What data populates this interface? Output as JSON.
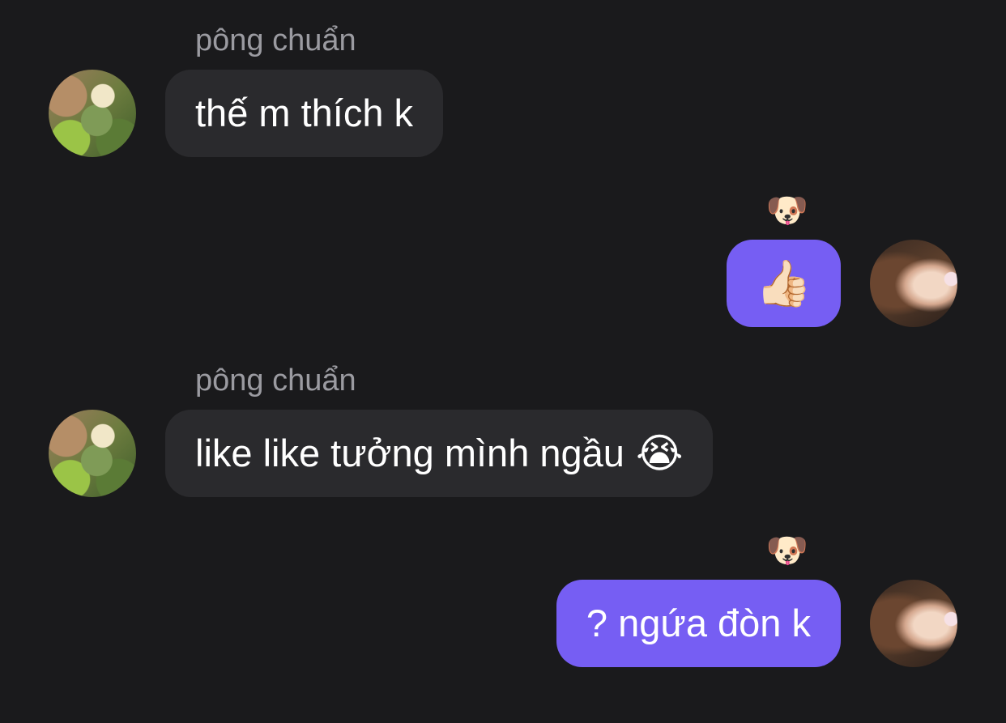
{
  "messages": [
    {
      "direction": "incoming",
      "sender": "pông chuẩn",
      "text": "thế m thích k",
      "emoji": ""
    },
    {
      "direction": "outgoing",
      "text": "👍🏻",
      "reaction": "🐶"
    },
    {
      "direction": "incoming",
      "sender": "pông chuẩn",
      "text": "like like tưởng mình ngầu",
      "emoji": "😭"
    },
    {
      "direction": "outgoing",
      "text": "? ngứa đòn k",
      "reaction": "🐶"
    }
  ],
  "colors": {
    "background": "#1a1a1c",
    "incoming_bubble": "#2a2a2d",
    "outgoing_bubble": "#765ef3",
    "sender_name": "#9b9ba1",
    "message_text": "#ffffff"
  }
}
